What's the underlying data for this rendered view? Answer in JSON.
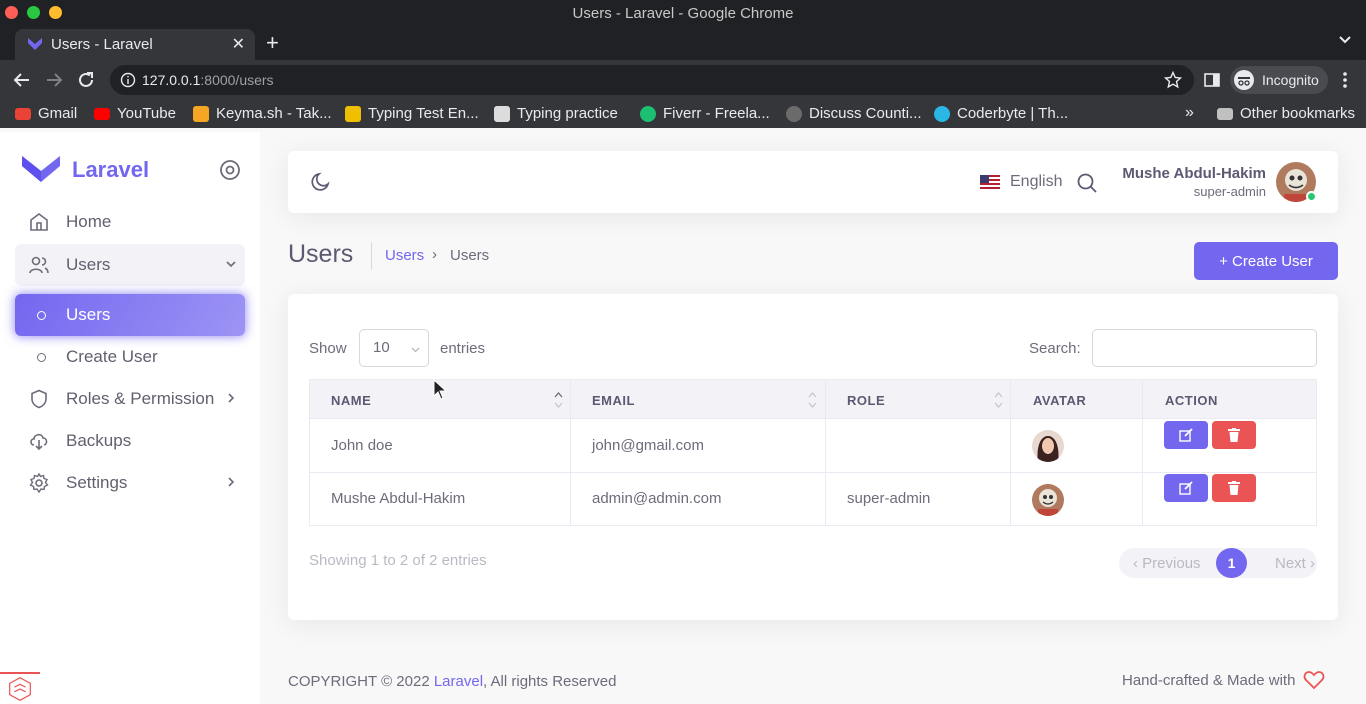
{
  "browser": {
    "window_title": "Users - Laravel - Google Chrome",
    "tab_title": "Users - Laravel",
    "url_host": "127.0.0.1",
    "url_rest": ":8000/users",
    "incognito_label": "Incognito",
    "bookmarks": [
      "Gmail",
      "YouTube",
      "Keyma.sh - Tak...",
      "Typing Test En...",
      "Typing practice",
      "Fiverr - Freela...",
      "Discuss Counti...",
      "Coderbyte | Th..."
    ],
    "other_bookmarks": "Other bookmarks"
  },
  "sidebar": {
    "brand": "Laravel",
    "items": [
      {
        "label": "Home"
      },
      {
        "label": "Users"
      },
      {
        "label": "Users"
      },
      {
        "label": "Create User"
      },
      {
        "label": "Roles & Permission"
      },
      {
        "label": "Backups"
      },
      {
        "label": "Settings"
      }
    ]
  },
  "navbar": {
    "language": "English",
    "user_name": "Mushe Abdul-Hakim",
    "user_role": "super-admin"
  },
  "page": {
    "title": "Users",
    "breadcrumb_link": "Users",
    "breadcrumb_current": "Users",
    "create_button": "+ Create User"
  },
  "table": {
    "show_label": "Show",
    "entries_value": "10",
    "entries_label": "entries",
    "search_label": "Search:",
    "headers": [
      "NAME",
      "EMAIL",
      "ROLE",
      "AVATAR",
      "ACTION"
    ],
    "rows": [
      {
        "name": "John doe",
        "email": "john@gmail.com",
        "role": ""
      },
      {
        "name": "Mushe Abdul-Hakim",
        "email": "admin@admin.com",
        "role": "super-admin"
      }
    ],
    "info": "Showing 1 to 2 of 2 entries",
    "prev": "Previous",
    "page": "1",
    "next": "Next"
  },
  "footer": {
    "copyright_prefix": "COPYRIGHT © 2022 ",
    "copyright_link": "Laravel",
    "copyright_suffix": ", All rights Reserved",
    "right": "Hand-crafted & Made with"
  },
  "colors": {
    "primary": "#7367f0",
    "danger": "#ea5455",
    "success": "#28c76f"
  }
}
